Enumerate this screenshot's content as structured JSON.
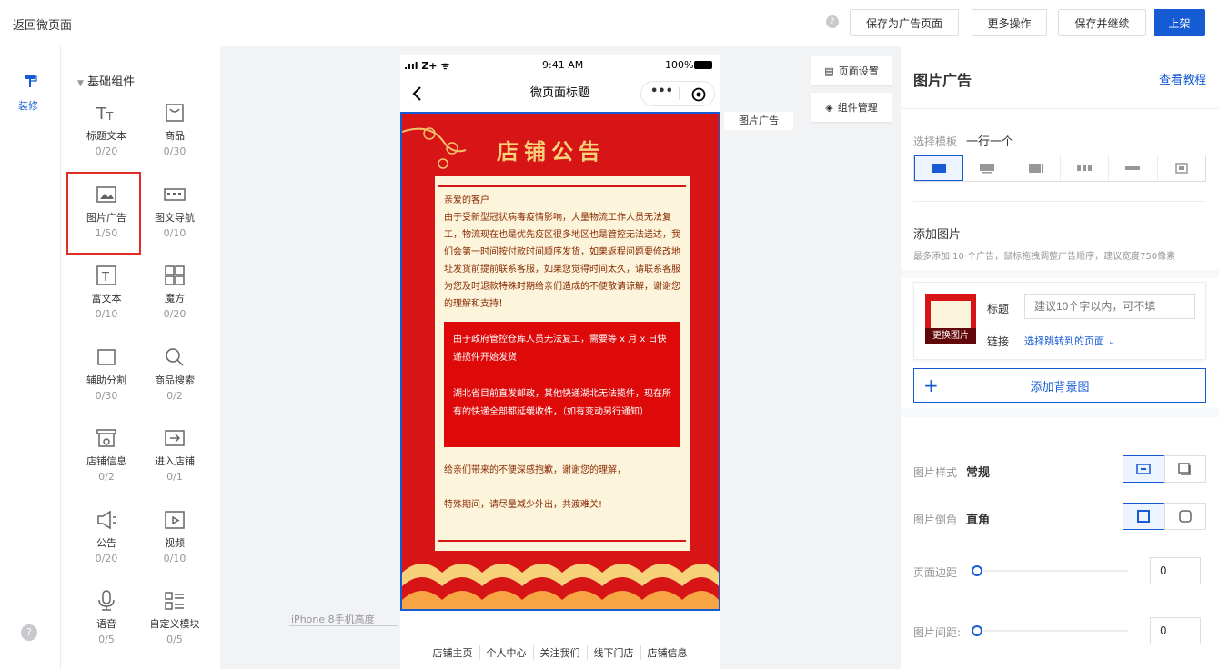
{
  "topbar": {
    "back": "返回微页面",
    "btn_save_ad": "保存为广告页面",
    "btn_more": "更多操作",
    "btn_save_continue": "保存并继续",
    "btn_publish": "上架"
  },
  "leftnav": {
    "decorate": "装修"
  },
  "components": {
    "group_title": "基础组件",
    "items": [
      {
        "name": "标题文本",
        "count": "0/20",
        "icon": "title-text-icon"
      },
      {
        "name": "商品",
        "count": "0/30",
        "icon": "goods-icon"
      },
      {
        "name": "图片广告",
        "count": "1/50",
        "icon": "image-ad-icon"
      },
      {
        "name": "图文导航",
        "count": "0/10",
        "icon": "image-nav-icon"
      },
      {
        "name": "富文本",
        "count": "0/10",
        "icon": "rich-text-icon"
      },
      {
        "name": "魔方",
        "count": "0/20",
        "icon": "cube-icon"
      },
      {
        "name": "辅助分割",
        "count": "0/30",
        "icon": "divider-icon"
      },
      {
        "name": "商品搜索",
        "count": "0/2",
        "icon": "search-icon"
      },
      {
        "name": "店铺信息",
        "count": "0/2",
        "icon": "store-info-icon"
      },
      {
        "name": "进入店铺",
        "count": "0/1",
        "icon": "enter-store-icon"
      },
      {
        "name": "公告",
        "count": "0/20",
        "icon": "announcement-icon"
      },
      {
        "name": "视频",
        "count": "0/10",
        "icon": "video-icon"
      },
      {
        "name": "语音",
        "count": "0/5",
        "icon": "voice-icon"
      },
      {
        "name": "自定义模块",
        "count": "0/5",
        "icon": "custom-module-icon"
      }
    ]
  },
  "phone": {
    "carrier": ".ııl Z+ ᯤ",
    "time": "9:41 AM",
    "battery": "100%",
    "page_title": "微页面标题",
    "more": "•••"
  },
  "poster": {
    "heading": "店铺公告",
    "greeting": "亲爱的客户",
    "para1": "由于受新型冠状病毒疫情影响，大量物流工作人员无法复工，物流现在也是优先疫区很多地区也是管控无法送达，我们会第一时间按付款时间顺序发货，如果返程问题要修改地址发货前提前联系客服，如果您觉得时间太久，请联系客服为您及时退款特殊时期给亲们造成的不便敬请谅解，谢谢您的理解和支持！",
    "red1": "由于政府管控仓库人员无法复工，需要等 x 月 x 日快递揽件开始发货",
    "red2": "湖北省目前直发邮政，其他快递湖北无法揽件，现在所有的快递全部都延缓收件，（如有变动另行通知）",
    "para2": "给亲们带来的不便深感抱歉，谢谢您的理解，",
    "para3": "特殊期间，请尽量减少外出，共渡难关!"
  },
  "canvas": {
    "iphone_label": "iPhone 8手机高度",
    "tag": "图片广告",
    "page_settings": "页面设置",
    "component_mgmt": "组件管理"
  },
  "footer": {
    "items": [
      "店铺主页",
      "个人中心",
      "关注我们",
      "线下门店",
      "店铺信息"
    ]
  },
  "rpanel": {
    "title": "图片广告",
    "tutorial": "查看教程",
    "template_label": "选择模板",
    "template_value": "一行一个",
    "add_image": "添加图片",
    "add_hint": "最多添加 10 个广告，鼠标拖拽调整广告顺序，建议宽度750像素",
    "title_label": "标题",
    "title_placeholder": "建议10个字以内，可不填",
    "link_label": "链接",
    "link_value": "选择跳转到的页面",
    "replace": "更换图片",
    "add_bg": "添加背景图",
    "img_style_label": "图片样式",
    "img_style_value": "常规",
    "corner_label": "图片倒角",
    "corner_value": "直角",
    "margin_label": "页面边距",
    "margin_value": "0",
    "spacing_label": "图片间距:",
    "spacing_value": "0"
  },
  "colors": {
    "accent": "#155bd4",
    "poster_red": "#d71517",
    "highlight": "#e02e24"
  }
}
